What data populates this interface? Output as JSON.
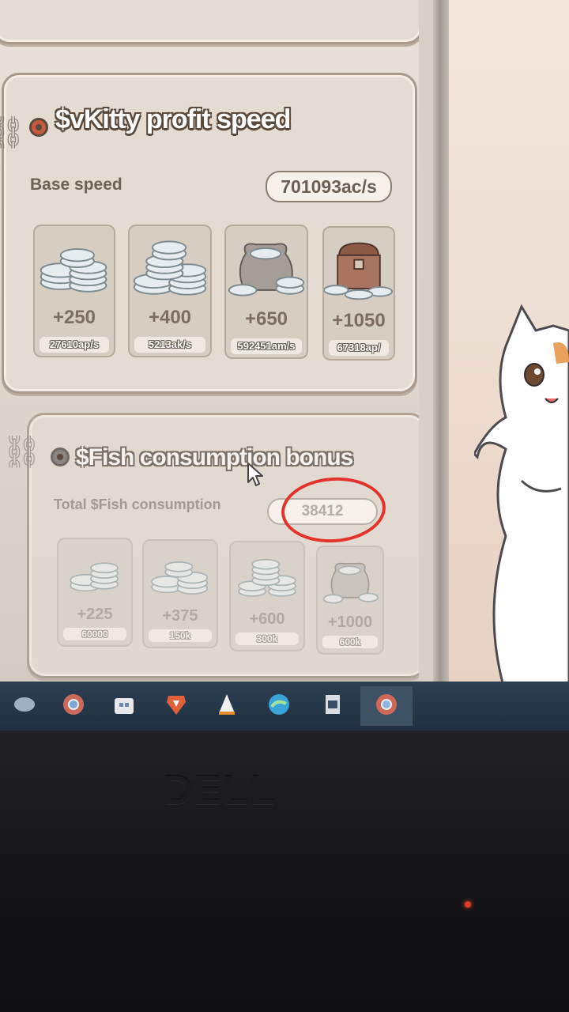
{
  "profit": {
    "title": "$vKitty profit speed",
    "base_label": "Base speed",
    "base_value": "701093ac/s",
    "cards": [
      {
        "value": "+250",
        "rate": "27610ap/s",
        "icon": "coin-stack-small-icon"
      },
      {
        "value": "+400",
        "rate": "5213ak/s",
        "icon": "coin-stack-large-icon"
      },
      {
        "value": "+650",
        "rate": "592451am/s",
        "icon": "coin-sack-icon"
      },
      {
        "value": "+1050",
        "rate": "67318ap/",
        "icon": "treasure-chest-icon"
      }
    ]
  },
  "fish": {
    "title": "$Fish consumption bonus",
    "total_label": "Total $Fish consumption",
    "total_value": "38412",
    "cards": [
      {
        "value": "+225",
        "requirement": "60000",
        "icon": "coin-stack-small-icon"
      },
      {
        "value": "+375",
        "requirement": "150k",
        "icon": "coin-stack-medium-icon"
      },
      {
        "value": "+600",
        "requirement": "300k",
        "icon": "coin-stack-large-icon"
      },
      {
        "value": "+1000",
        "requirement": "600k",
        "icon": "coin-sack-icon"
      }
    ]
  },
  "laptop": {
    "brand": "DELL"
  },
  "colors": {
    "annotation": "#e2332c",
    "title_outline": "#5a4a3e",
    "taskbar": "#2c3f52"
  }
}
